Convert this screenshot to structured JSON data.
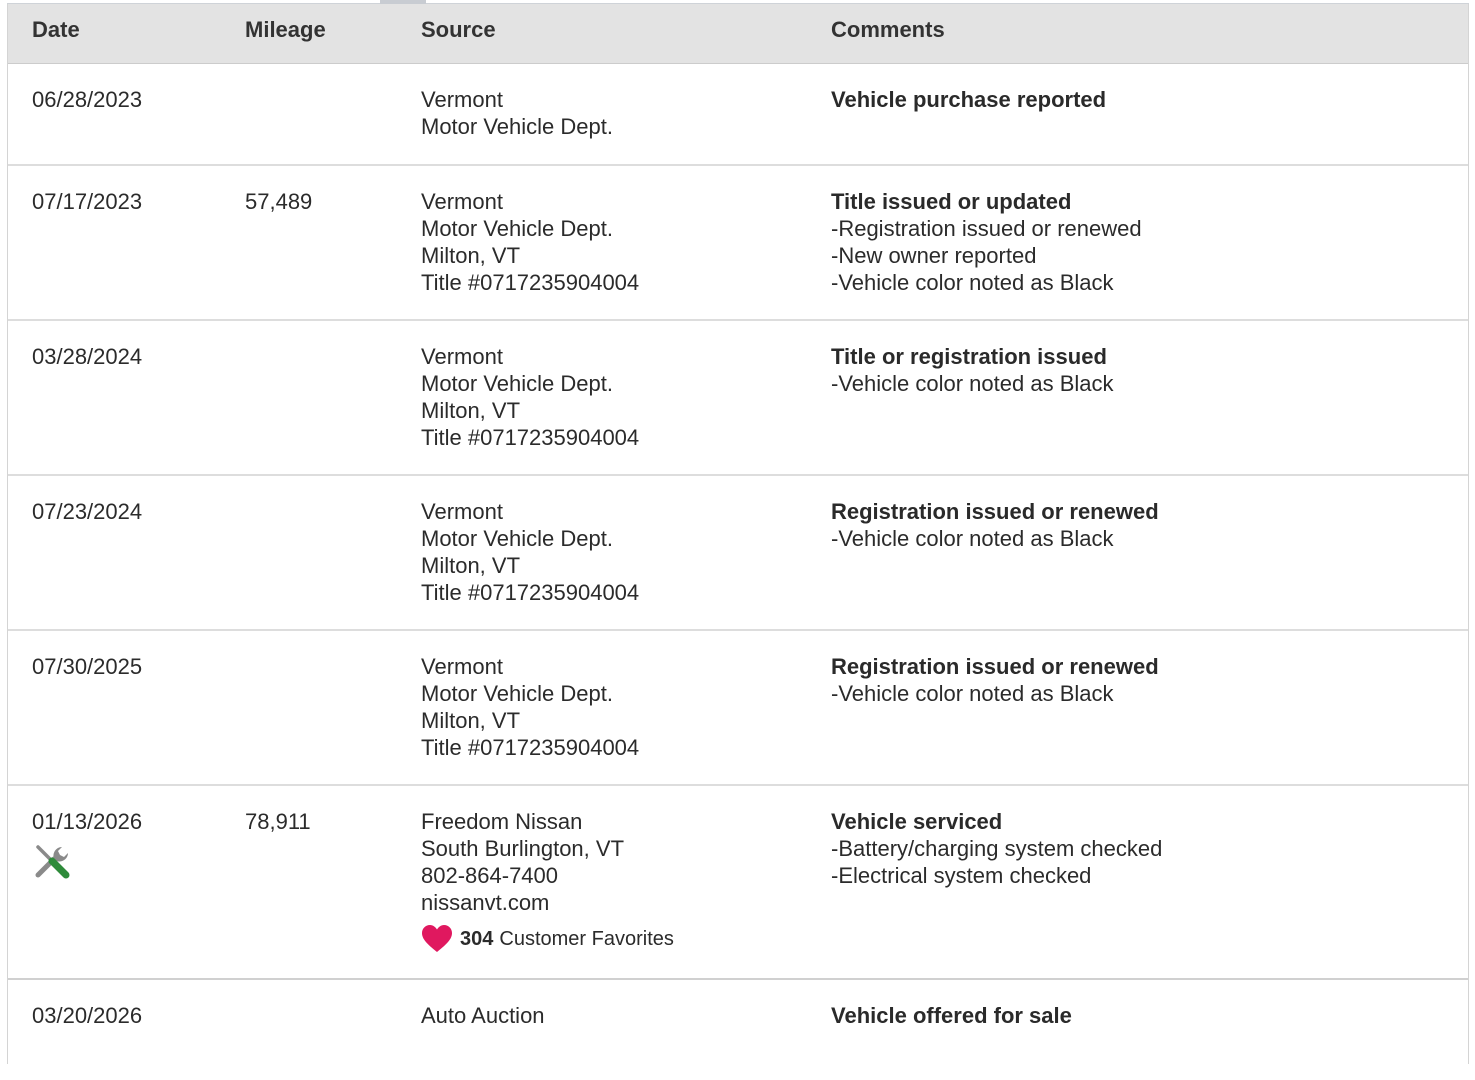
{
  "header": {
    "date": "Date",
    "mileage": "Mileage",
    "source": "Source",
    "comments": "Comments"
  },
  "rows": [
    {
      "date": "06/28/2023",
      "mileage": "",
      "source": [
        "Vermont",
        "Motor Vehicle Dept."
      ],
      "title": "Vehicle purchase reported",
      "details": []
    },
    {
      "date": "07/17/2023",
      "mileage": "57,489",
      "source": [
        "Vermont",
        "Motor Vehicle Dept.",
        "Milton, VT",
        "Title #0717235904004"
      ],
      "title": "Title issued or updated",
      "details": [
        "Registration issued or renewed",
        "New owner reported",
        "Vehicle color noted as Black"
      ]
    },
    {
      "date": "03/28/2024",
      "mileage": "",
      "source": [
        "Vermont",
        "Motor Vehicle Dept.",
        "Milton, VT",
        "Title #0717235904004"
      ],
      "title": "Title or registration issued",
      "details": [
        "Vehicle color noted as Black"
      ]
    },
    {
      "date": "07/23/2024",
      "mileage": "",
      "source": [
        "Vermont",
        "Motor Vehicle Dept.",
        "Milton, VT",
        "Title #0717235904004"
      ],
      "title": "Registration issued or renewed",
      "details": [
        "Vehicle color noted as Black"
      ]
    },
    {
      "date": "07/30/2025",
      "mileage": "",
      "source": [
        "Vermont",
        "Motor Vehicle Dept.",
        "Milton, VT",
        "Title #0717235904004"
      ],
      "title": "Registration issued or renewed",
      "details": [
        "Vehicle color noted as Black"
      ]
    },
    {
      "date": "01/13/2026",
      "mileage": "78,911",
      "source": [
        "Freedom Nissan",
        "South Burlington, VT",
        "802-864-7400",
        "nissanvt.com"
      ],
      "favorites": {
        "count": "304",
        "label": "Customer Favorites"
      },
      "icon": "service-wrench-screwdriver-icon",
      "title": "Vehicle serviced",
      "details": [
        "Battery/charging system checked",
        "Electrical system checked"
      ]
    },
    {
      "date": "03/20/2026",
      "mileage": "",
      "source": [
        "Auto Auction"
      ],
      "title": "Vehicle offered for sale",
      "details": []
    }
  ],
  "colors": {
    "header_bg": "#e3e3e3",
    "heart": "#e0185f",
    "wrench_gray": "#8a8a8a",
    "screwdriver_green": "#2e8b3a"
  }
}
